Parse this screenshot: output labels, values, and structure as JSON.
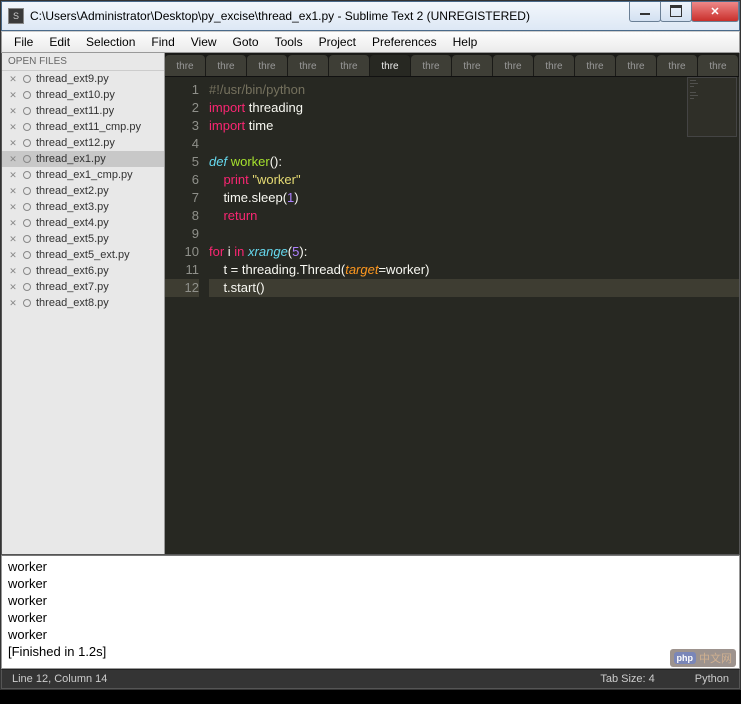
{
  "window": {
    "title": "C:\\Users\\Administrator\\Desktop\\py_excise\\thread_ex1.py - Sublime Text 2 (UNREGISTERED)"
  },
  "menu": [
    "File",
    "Edit",
    "Selection",
    "Find",
    "View",
    "Goto",
    "Tools",
    "Project",
    "Preferences",
    "Help"
  ],
  "sidebar": {
    "header": "OPEN FILES",
    "files": [
      {
        "name": "thread_ext9.py",
        "active": false
      },
      {
        "name": "thread_ext10.py",
        "active": false
      },
      {
        "name": "thread_ext11.py",
        "active": false
      },
      {
        "name": "thread_ext11_cmp.py",
        "active": false
      },
      {
        "name": "thread_ext12.py",
        "active": false
      },
      {
        "name": "thread_ex1.py",
        "active": true
      },
      {
        "name": "thread_ex1_cmp.py",
        "active": false
      },
      {
        "name": "thread_ext2.py",
        "active": false
      },
      {
        "name": "thread_ext3.py",
        "active": false
      },
      {
        "name": "thread_ext4.py",
        "active": false
      },
      {
        "name": "thread_ext5.py",
        "active": false
      },
      {
        "name": "thread_ext5_ext.py",
        "active": false
      },
      {
        "name": "thread_ext6.py",
        "active": false
      },
      {
        "name": "thread_ext7.py",
        "active": false
      },
      {
        "name": "thread_ext8.py",
        "active": false
      }
    ]
  },
  "tabs": {
    "labels": [
      "thre",
      "thre",
      "thre",
      "thre",
      "thre",
      "thre",
      "thre",
      "thre",
      "thre",
      "thre",
      "thre",
      "thre",
      "thre",
      "thre"
    ],
    "active_index": 5
  },
  "code": {
    "lines": [
      {
        "n": 1,
        "tokens": [
          {
            "t": "#!/usr/bin/python",
            "c": "c-comment"
          }
        ]
      },
      {
        "n": 2,
        "tokens": [
          {
            "t": "import",
            "c": "c-keyword"
          },
          {
            "t": " threading",
            "c": "c-plain"
          }
        ]
      },
      {
        "n": 3,
        "tokens": [
          {
            "t": "import",
            "c": "c-keyword"
          },
          {
            "t": " time",
            "c": "c-plain"
          }
        ]
      },
      {
        "n": 4,
        "tokens": []
      },
      {
        "n": 5,
        "tokens": [
          {
            "t": "def",
            "c": "c-keyword-it"
          },
          {
            "t": " ",
            "c": "c-plain"
          },
          {
            "t": "worker",
            "c": "c-func"
          },
          {
            "t": "():",
            "c": "c-plain"
          }
        ]
      },
      {
        "n": 6,
        "tokens": [
          {
            "t": "    ",
            "c": "c-plain"
          },
          {
            "t": "print",
            "c": "c-keyword"
          },
          {
            "t": " ",
            "c": "c-plain"
          },
          {
            "t": "\"worker\"",
            "c": "c-string"
          }
        ]
      },
      {
        "n": 7,
        "tokens": [
          {
            "t": "    time.sleep(",
            "c": "c-plain"
          },
          {
            "t": "1",
            "c": "c-num"
          },
          {
            "t": ")",
            "c": "c-plain"
          }
        ]
      },
      {
        "n": 8,
        "tokens": [
          {
            "t": "    ",
            "c": "c-plain"
          },
          {
            "t": "return",
            "c": "c-keyword"
          }
        ]
      },
      {
        "n": 9,
        "tokens": []
      },
      {
        "n": 10,
        "tokens": [
          {
            "t": "for",
            "c": "c-keyword"
          },
          {
            "t": " i ",
            "c": "c-plain"
          },
          {
            "t": "in",
            "c": "c-keyword"
          },
          {
            "t": " ",
            "c": "c-plain"
          },
          {
            "t": "xrange",
            "c": "c-keyword-it"
          },
          {
            "t": "(",
            "c": "c-plain"
          },
          {
            "t": "5",
            "c": "c-num"
          },
          {
            "t": "):",
            "c": "c-plain"
          }
        ]
      },
      {
        "n": 11,
        "tokens": [
          {
            "t": "    t = threading.Thread(",
            "c": "c-plain"
          },
          {
            "t": "target",
            "c": "c-param"
          },
          {
            "t": "=worker)",
            "c": "c-plain"
          }
        ]
      },
      {
        "n": 12,
        "tokens": [
          {
            "t": "    t.start()",
            "c": "c-plain"
          }
        ],
        "current": true
      }
    ]
  },
  "console": {
    "lines": [
      "worker",
      "worker",
      "worker",
      "worker",
      "worker",
      "[Finished in 1.2s]"
    ]
  },
  "status": {
    "left": "Line 12, Column 14",
    "tab_size": "Tab Size: 4",
    "lang": "Python"
  },
  "watermark": {
    "php": "php",
    "text": "中文网"
  }
}
